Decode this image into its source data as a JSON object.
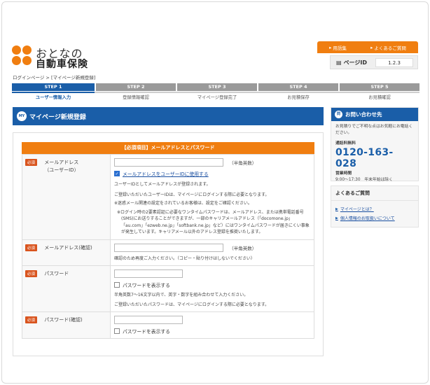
{
  "header": {
    "logo_line1": "おとなの",
    "logo_line2": "自動車保険",
    "top_links": [
      {
        "label": "用語集"
      },
      {
        "label": "よくあるご質問"
      }
    ],
    "page_id_label": "ページID",
    "page_id_value": "1.2.3"
  },
  "breadcrumb": "ログインページ > [マイページ新規登録]",
  "steps": [
    {
      "label": "STEP",
      "num": "1",
      "caption": "ユーザー情報入力",
      "active": true
    },
    {
      "label": "STEP",
      "num": "2",
      "caption": "登録情報確認",
      "active": false
    },
    {
      "label": "STEP",
      "num": "3",
      "caption": "マイページ登録完了",
      "active": false
    },
    {
      "label": "STEP",
      "num": "4",
      "caption": "お見積保存",
      "active": false
    },
    {
      "label": "STEP",
      "num": "5",
      "caption": "お見積確認",
      "active": false
    }
  ],
  "main": {
    "badge": "MY",
    "title": "マイページ新規登録",
    "section_title": "【必須項目】メールアドレスとパスワード",
    "required_tag": "必須",
    "fields": {
      "email": {
        "label_line1": "メールアドレス",
        "label_line2": "（ユーザーID）",
        "suffix": "（半角英数）",
        "checkbox_label": "メールアドレスをユーザーIDに使用する",
        "checked": true,
        "notes": [
          "ユーザーIDとしてメールアドレスが登録されます。",
          "ご登録いただいたユーザーIDは、マイページにログインする際に必要となります。",
          "※迷惑メール関連の設定をされているお客様は、設定をご確認ください。"
        ],
        "sub_note": "※ログイン時の2要素認証に必要なワンタイムパスワードは、メールアドレス、または携帯電話番号(SMS)にお送りすることができますが、一部のキャリアメールアドレス（「docomone.jp」「au.com」「ezweb.ne.jp」「softbank.ne.jp」など）にはワンタイムパスワードが届きにくい事象が発生しています。キャリアメール以外のアドレス登録を推奨いたします。"
      },
      "email_confirm": {
        "label": "メールアドレス(確認)",
        "suffix": "（半角英数）",
        "note": "確認のため再度ご入力ください。（コピー・貼り付けはしないでください）"
      },
      "password": {
        "label": "パスワード",
        "checkbox_label": "パスワードを表示する",
        "notes": [
          "半角英数7～16文字以内で、英字・数字を組み合わせて入力ください。",
          "ご登録いただいたパスワードは、マイページにログインする際に必要となります。"
        ]
      },
      "password_confirm": {
        "label": "パスワード(確認)",
        "checkbox_label": "パスワードを表示する"
      }
    }
  },
  "sidebar": {
    "contact": {
      "badge": "問",
      "title": "お問い合わせ先",
      "desc": "お見積りでご不明な点はお気軽にお電話ください。",
      "free_label": "通話料無料",
      "phone": "0120-163-028",
      "hours_label": "営業時間",
      "hours": "9:00～17:30　年末年始は除く"
    },
    "faq": {
      "title": "よくあるご質問",
      "items": [
        {
          "label": "マイページとは？"
        },
        {
          "label": "個人情報のお取扱いについて"
        }
      ]
    }
  },
  "colors": {
    "brand_orange": "#f07e10",
    "brand_blue": "#1a5ea8",
    "required_red": "#d9541e"
  }
}
